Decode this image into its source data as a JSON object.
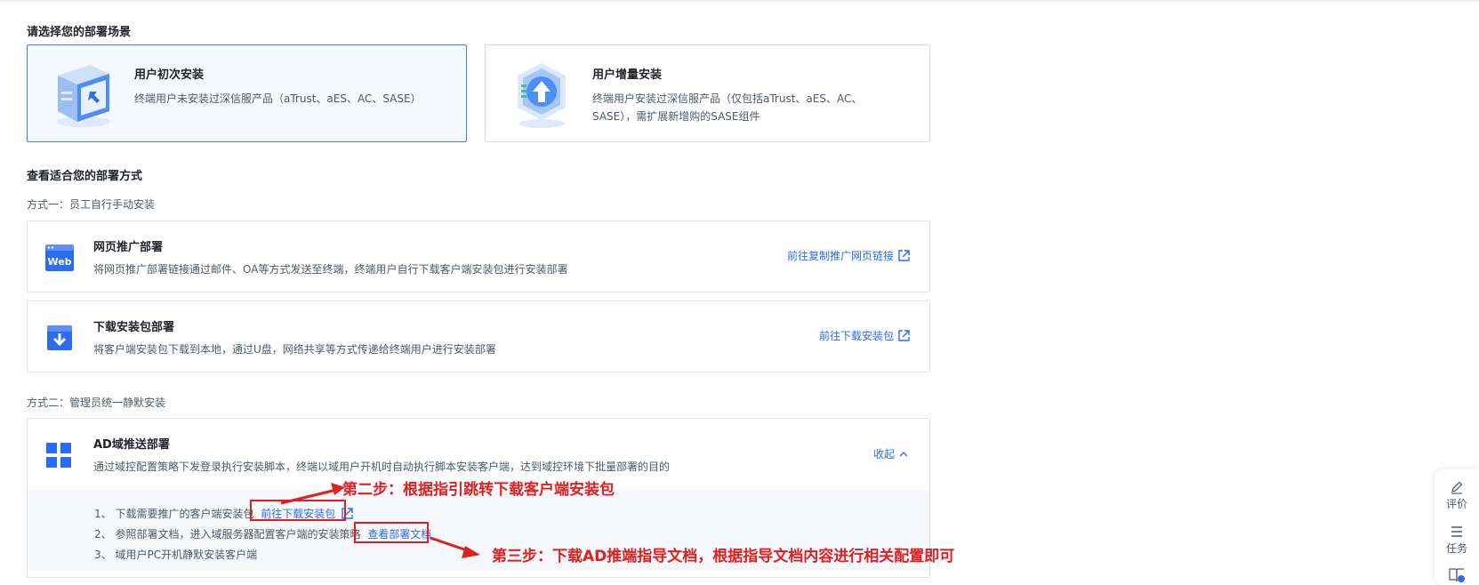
{
  "scene_section": {
    "title": "请选择您的部署场景"
  },
  "scenes": [
    {
      "title": "用户初次安装",
      "desc": "终端用户未安装过深信服产品（aTrust、aES、AC、SASE）"
    },
    {
      "title": "用户增量安装",
      "desc": "终端用户安装过深信服产品（仅包括aTrust、aES、AC、SASE），需扩展新增购的SASE组件"
    }
  ],
  "method_section": {
    "title": "查看适合您的部署方式"
  },
  "way1_label": "方式一：员工自行手动安装",
  "way2_label": "方式二：管理员统一静默安装",
  "methods": [
    {
      "title": "网页推广部署",
      "desc": "将网页推广部署链接通过邮件、OA等方式发送至终端，终端用户自行下载客户端安装包进行安装部署",
      "link": "前往复制推广网页链接",
      "icon_text": "Web"
    },
    {
      "title": "下载安装包部署",
      "desc": "将客户端安装包下载到本地，通过U盘，网络共享等方式传递给终端用户进行安装部署",
      "link": "前往下载安装包"
    }
  ],
  "ad": {
    "title": "AD域推送部署",
    "desc": "通过域控配置策略下发登录执行安装脚本，终端以域用户开机时自动执行脚本安装客户端，达到域控环境下批量部署的目的",
    "collapse": "收起",
    "steps": [
      {
        "prefix": "1、 下载需要推广的客户端安装包",
        "link": "前往下载安装包"
      },
      {
        "prefix": "2、 参照部署文档，进入域服务器配置客户端的安装策略",
        "link": "查看部署文档"
      },
      {
        "prefix": "3、 域用户PC开机静默安装客户端"
      }
    ]
  },
  "annotations": {
    "step2": "第二步：根据指引跳转下载客户端安装包",
    "step3": "第三步：下载AD推端指导文档，根据指导文档内容进行相关配置即可",
    "color": "#e02020"
  },
  "side": {
    "review": "评价",
    "task": "任务"
  },
  "colors": {
    "accent": "#2b6cf0",
    "active_border": "#3b7cf5"
  }
}
